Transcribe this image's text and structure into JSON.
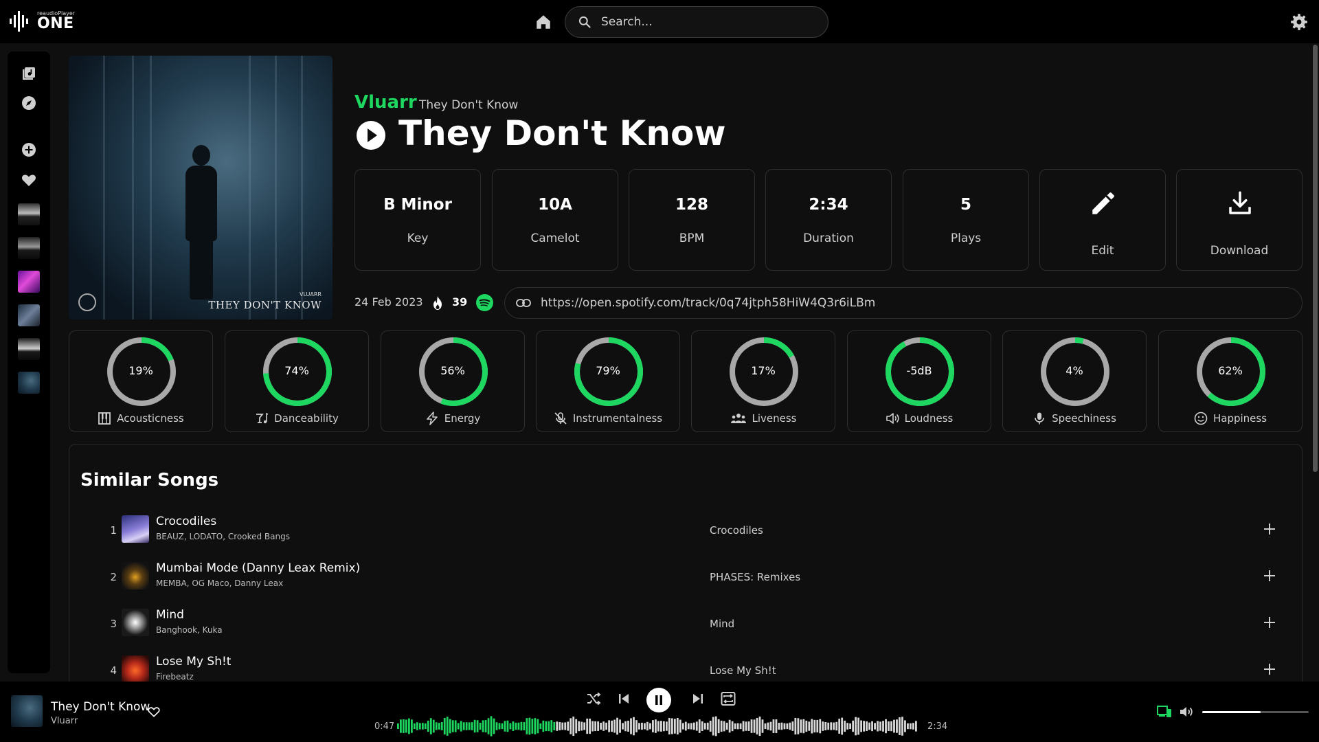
{
  "app": {
    "logo_small": "reaudioPlayer",
    "logo_big": "ONE"
  },
  "search": {
    "placeholder": "Search..."
  },
  "track": {
    "artist": "Vluarr",
    "album": "They Don't Know",
    "title": "They Don't Know",
    "album_art_text": "THEY DON'T KNOW",
    "album_art_artist": "VLUARR",
    "release_date": "24 Feb 2023",
    "popularity": "39",
    "spotify_url": "https://open.spotify.com/track/0q74jtph58HiW4Q3r6iLBm"
  },
  "stats": [
    {
      "value": "B Minor",
      "label": "Key"
    },
    {
      "value": "10A",
      "label": "Camelot"
    },
    {
      "value": "128",
      "label": "BPM"
    },
    {
      "value": "2:34",
      "label": "Duration"
    },
    {
      "value": "5",
      "label": "Plays"
    }
  ],
  "actions": {
    "edit": "Edit",
    "download": "Download"
  },
  "features": [
    {
      "value": "19%",
      "label": "Acousticness",
      "fraction": 0.19,
      "icon": "piano-icon"
    },
    {
      "value": "74%",
      "label": "Danceability",
      "fraction": 0.74,
      "icon": "dance-icon"
    },
    {
      "value": "56%",
      "label": "Energy",
      "fraction": 0.56,
      "icon": "bolt-icon"
    },
    {
      "value": "79%",
      "label": "Instrumentalness",
      "fraction": 0.79,
      "icon": "mic-off-icon"
    },
    {
      "value": "17%",
      "label": "Liveness",
      "fraction": 0.17,
      "icon": "people-icon"
    },
    {
      "value": "-5dB",
      "label": "Loudness",
      "fraction": 0.92,
      "icon": "speaker-icon"
    },
    {
      "value": "4%",
      "label": "Speechiness",
      "fraction": 0.04,
      "icon": "mic-icon"
    },
    {
      "value": "62%",
      "label": "Happiness",
      "fraction": 0.62,
      "icon": "smile-icon"
    }
  ],
  "similar": {
    "title": "Similar Songs",
    "songs": [
      {
        "num": "1",
        "title": "Crocodiles",
        "artists": "BEAUZ, LODATO, Crooked Bangs",
        "album": "Crocodiles"
      },
      {
        "num": "2",
        "title": "Mumbai Mode (Danny Leax Remix)",
        "artists": "MEMBA, OG Maco, Danny Leax",
        "album": "PHASES: Remixes"
      },
      {
        "num": "3",
        "title": "Mind",
        "artists": "Banghook, Kuka",
        "album": "Mind"
      },
      {
        "num": "4",
        "title": "Lose My Sh!t",
        "artists": "Firebeatz",
        "album": "Lose My Sh!t"
      }
    ]
  },
  "player": {
    "title": "They Don't Know",
    "artist": "Vluarr",
    "elapsed": "0:47",
    "total": "2:34",
    "progress": 0.305,
    "volume": 0.55
  },
  "colors": {
    "accent": "#1ed760",
    "ring_track": "#a8a8a8",
    "background": "#0f0f0f"
  }
}
